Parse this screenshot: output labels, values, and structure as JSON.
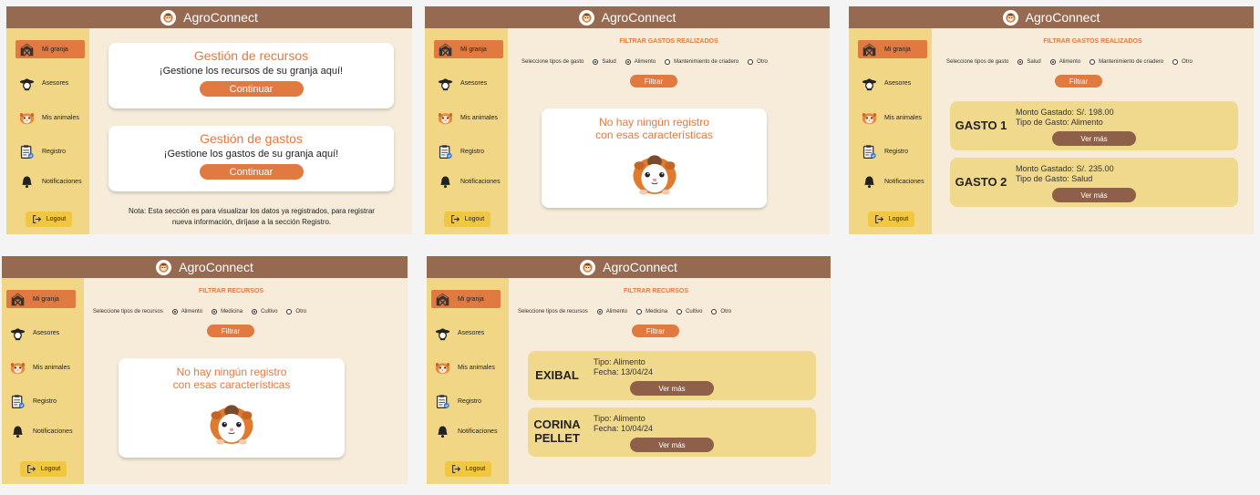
{
  "app": {
    "title": "AgroConnect"
  },
  "sidebar": {
    "items": [
      {
        "label": "Mi granja",
        "icon": "barn-icon"
      },
      {
        "label": "Asesores",
        "icon": "farmer-icon"
      },
      {
        "label": "Mis animales",
        "icon": "guinea-pig-icon"
      },
      {
        "label": "Registro",
        "icon": "clipboard-icon"
      },
      {
        "label": "Notificaciones",
        "icon": "bell-icon"
      }
    ],
    "logout": "Logout"
  },
  "screen1": {
    "cards": [
      {
        "title": "Gestión de recursos",
        "text": "¡Gestione los recursos de su granja aquí!",
        "button": "Continuar"
      },
      {
        "title": "Gestión de gastos",
        "text": "¡Gestione los gastos de su granja aquí!",
        "button": "Continuar"
      }
    ],
    "note_line1": "Nota: Esta sección es para visualizar los datos ya registrados, para registrar",
    "note_line2": "nueva información, diríjase a la sección Registro."
  },
  "gastos_filter": {
    "title": "FILTRAR GASTOS REALIZADOS",
    "label": "Seleccione tipos de gasto",
    "options": [
      "Salud",
      "Alimento",
      "Mantenimiento de criadero",
      "Otro"
    ],
    "button": "Filtrar"
  },
  "recursos_filter": {
    "title": "FILTRAR RECURSOS",
    "label": "Seleccione tipos de recursos",
    "options": [
      "Alimento",
      "Medicina",
      "Cultivo",
      "Otro"
    ],
    "button": "Filtrar"
  },
  "empty": {
    "line1": "No hay ningún registro",
    "line2": "con esas características"
  },
  "gastos": [
    {
      "name": "GASTO 1",
      "monto": "Monto Gastado: S/. 198.00",
      "tipo": "Tipo de Gasto: Alimento",
      "button": "Ver más"
    },
    {
      "name": "GASTO 2",
      "monto": "Monto Gastado: S/. 235.00",
      "tipo": "Tipo de Gasto: Salud",
      "button": "Ver más"
    }
  ],
  "recursos": [
    {
      "name_line1": "EXIBAL",
      "name_line2": "",
      "tipo": "Tipo: Alimento",
      "fecha": "Fecha: 13/04/24",
      "button": "Ver más"
    },
    {
      "name_line1": "CORINA",
      "name_line2": "PELLET",
      "tipo": "Tipo: Alimento",
      "fecha": "Fecha: 10/04/24",
      "button": "Ver más"
    }
  ],
  "radio_state": {
    "screen2": [
      true,
      true,
      false,
      false
    ],
    "screen3": [
      true,
      true,
      false,
      false
    ],
    "screen4": [
      true,
      true,
      true,
      false
    ],
    "screen5": [
      true,
      false,
      false,
      false
    ]
  },
  "colors": {
    "header": "#956a51",
    "sidebar": "#f1d785",
    "accent": "#e07a41",
    "background": "#f6ecd9",
    "result_card": "#f0d98c",
    "vermas": "#8f6049",
    "logout": "#f1c642"
  }
}
